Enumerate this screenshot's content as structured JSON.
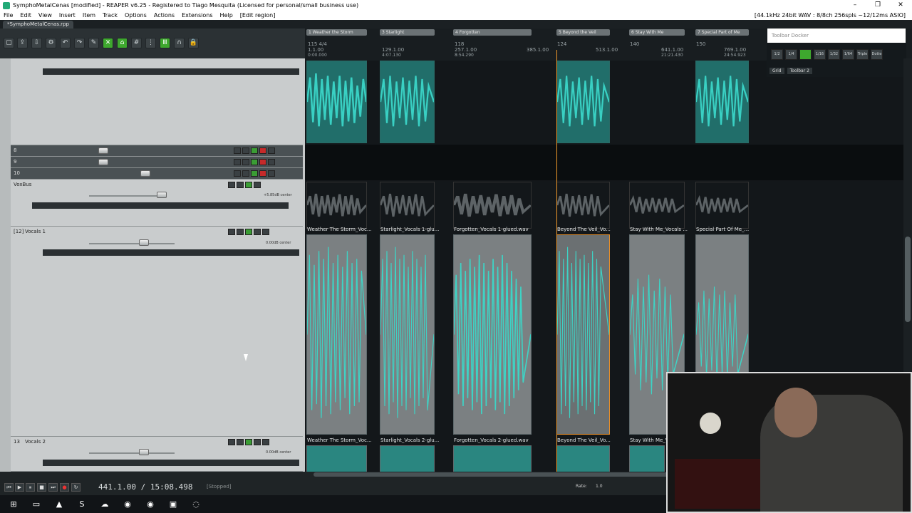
{
  "window": {
    "title": "SymphoMetalCenas [modified] - REAPER v6.25 - Registered to Tiago Mesquita (Licensed for personal/small business use)",
    "audio_status": "[44.1kHz 24bit WAV : 8/8ch 256spls ~12/12ms ASIO]"
  },
  "menu": [
    "File",
    "Edit",
    "View",
    "Insert",
    "Item",
    "Track",
    "Options",
    "Actions",
    "Extensions",
    "Help",
    "[Edit region]"
  ],
  "project_tab": "*SymphoMetalCenas.rpp",
  "regions": [
    {
      "label": "1 Weather the Storm"
    },
    {
      "label": "3 Starlight"
    },
    {
      "label": "4 Forgotten"
    },
    {
      "label": "5 Beyond the Veil"
    },
    {
      "label": "6 Stay With Me"
    },
    {
      "label": "7 Special Part of Me"
    }
  ],
  "ruler": {
    "marks": [
      "115 4/4",
      "1.1.00",
      "0:00.000",
      "129.1.00",
      "4:07.130",
      "118",
      "257.1.00",
      "8:54.290",
      "385.1.00",
      "124",
      "513.1.00",
      "140",
      "641.1.00",
      "21:21.430",
      "150",
      "769.1.00",
      "24:54.923"
    ]
  },
  "tracks": [
    {
      "num": "8",
      "name": ""
    },
    {
      "num": "9",
      "name": ""
    },
    {
      "num": "10",
      "name": ""
    },
    {
      "num": "",
      "name": "VoxBus",
      "volume": "+5.85dB center"
    },
    {
      "num": "[12]",
      "name": "Vocals 1",
      "volume": "0.00dB center"
    },
    {
      "num": "13",
      "name": "Vocals 2",
      "volume": "0.00dB center"
    }
  ],
  "items_vocals1": [
    "Weather The Storm_Voc...",
    "Starlight_Vocals 1-glu...",
    "Forgotten_Vocals 1-glued.wav",
    "Beyond The Veil_Vo...",
    "Stay With Me_Vocals ...",
    "Special Part Of Me_..."
  ],
  "items_vocals2": [
    "Weather The Storm_Voc...",
    "Starlight_Vocals 2-glu...",
    "Forgotten_Vocals 2-glued.wav",
    "Beyond The Veil_Vo...",
    "Stay With Me_V..."
  ],
  "docker": {
    "title": "Toolbar Docker",
    "grid_buttons": [
      "1/2",
      "1/4",
      "",
      "1/16",
      "1/32",
      "1/64",
      "Triple",
      "Dotte"
    ],
    "tabs": [
      "Grid",
      "Toolbar 2"
    ]
  },
  "transport": {
    "time": "441.1.00 / 15:08.498",
    "state": "[Stopped]",
    "rate_label": "Rate:",
    "rate_value": "1.0"
  },
  "colors": {
    "accent_teal": "#2a8680",
    "cursor": "#f29a2b",
    "arm_red": "#c62a2a",
    "active_green": "#3ea82e"
  }
}
